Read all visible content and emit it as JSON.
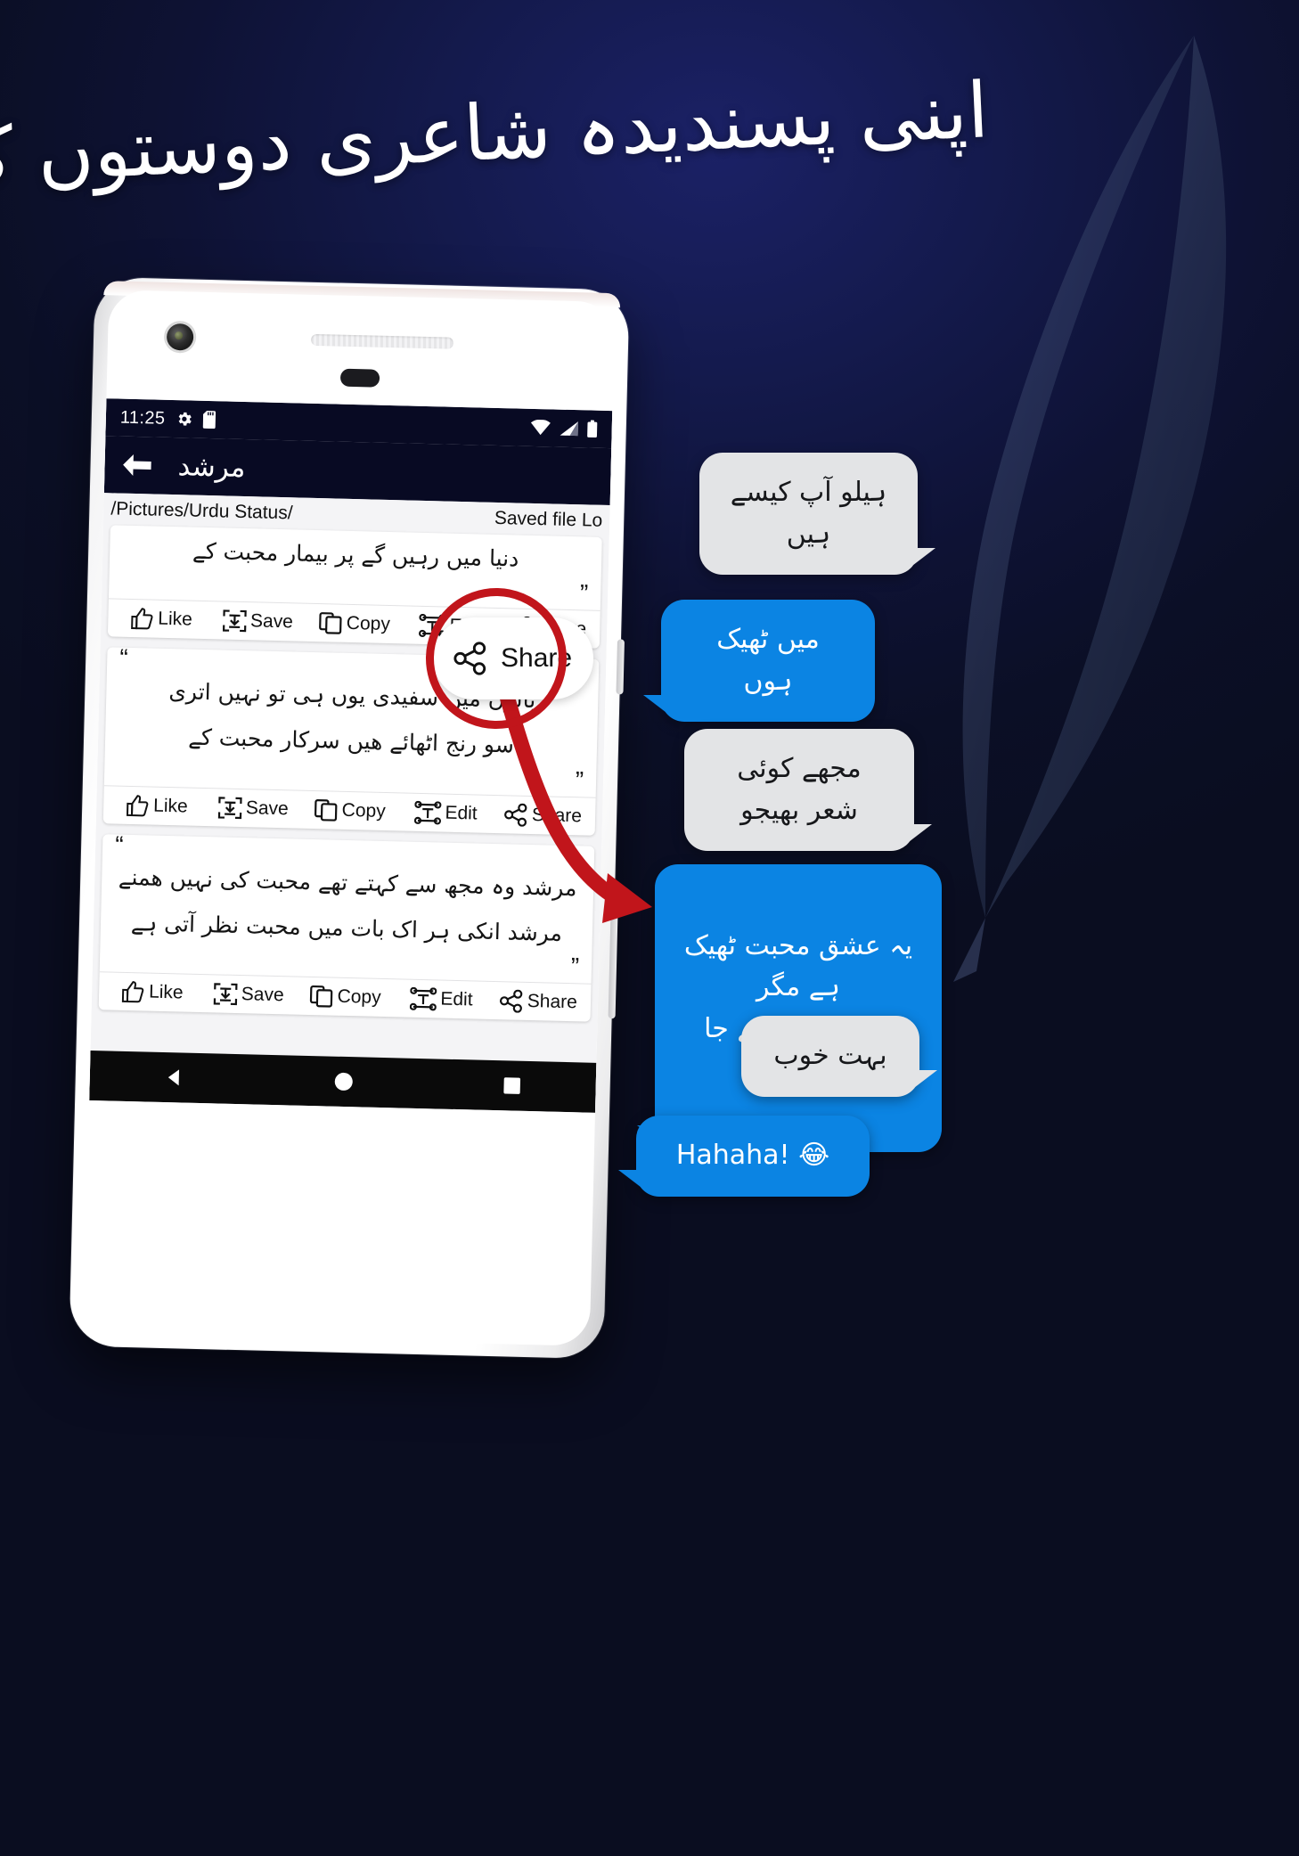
{
  "headline": "اپنی پسندیدہ شاعری دوستوں کو بھیجیں",
  "colors": {
    "background_top": "#1b2166",
    "background_bottom": "#0a0d20",
    "accent_blue": "#0b84e3",
    "bubble_grey": "#e3e4e6",
    "callout_red": "#c1151b",
    "statusbar": "#080a23"
  },
  "phone": {
    "statusbar": {
      "time": "11:25",
      "icons_left": [
        "gear-icon",
        "sd-card-icon"
      ],
      "icons_right": [
        "wifi-icon",
        "cellular-signal-icon",
        "battery-icon"
      ]
    },
    "appbar": {
      "back_icon": "back-arrow-icon",
      "title": "مرشد"
    },
    "saved_bar": {
      "path": "/Pictures/Urdu Status/",
      "label": "Saved file Lo"
    },
    "actions": {
      "like": "Like",
      "save": "Save",
      "copy": "Copy",
      "edit": "Edit",
      "share": "Share"
    },
    "cards": [
      {
        "lines": [
          "دنیا میں رہیں گے پر بیمار محبت کے"
        ],
        "actions": [
          "Like",
          "Save",
          "Copy",
          "Edit",
          "Share"
        ]
      },
      {
        "lines": [
          "بالوں میں سفیدی یوں ہی تو نہیں اتری",
          "سو رنج اٹھائے ھیں سرکار محبت کے"
        ],
        "actions": [
          "Like",
          "Save",
          "Copy",
          "Edit",
          "Share"
        ]
      },
      {
        "lines": [
          "مرشد وہ مجھ سے کہتے تھے محبت کی نہیں ھمنے",
          "مرشد انکی ہر اک بات میں محبت نظر آتی ہے"
        ],
        "actions": [
          "Like",
          "Save",
          "Copy",
          "Edit",
          "Share"
        ]
      }
    ],
    "navbar": [
      "back-triangle-icon",
      "home-circle-icon",
      "recents-square-icon"
    ]
  },
  "callout": {
    "label": "Share",
    "icon": "share-nodes-icon"
  },
  "chat": [
    {
      "side": "grey",
      "text": "ہیلو آپ کیسے ہیں"
    },
    {
      "side": "blue",
      "text": "میں ٹھیک ہوں"
    },
    {
      "side": "grey",
      "text": "مجھے کوئی شعر بھیجو"
    },
    {
      "side": "blue",
      "text": "یہ عشق محبت ٹھیک ہے مگر\nتم تو جان بنتے جا رہے ہو"
    },
    {
      "side": "grey",
      "text": "بہت خوب"
    },
    {
      "side": "blue",
      "text": "Hahaha! 😂"
    }
  ]
}
